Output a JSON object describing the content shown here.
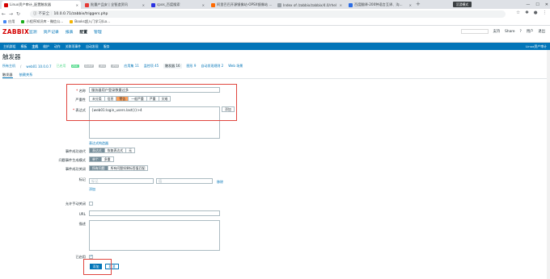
{
  "browser": {
    "tabs": [
      {
        "title": "Linux资产审计_配置触发器",
        "color": "#d40000",
        "active": true
      },
      {
        "title": "批量产品安 | 全智造资讯"
      },
      {
        "title": "cpos_百度搜索"
      },
      {
        "title": "阿里巴巴开源镜像站-OPSX镜像站 ..."
      },
      {
        "title": "Index of /zabbix/zabbix/4.0/rhel"
      },
      {
        "title": "百度翻译-200种语言互译、沟..."
      }
    ],
    "popup_tab": "沉浸模式",
    "new_tab": "+",
    "address": "10.0.0.71/zabbix/triggers.php",
    "insecure_label": "不安全",
    "bookmarks": [
      {
        "label": "应用",
        "color": "#4285f4"
      },
      {
        "label": "小程序知识库 - 微信公...",
        "color": "#1aad19"
      },
      {
        "label": "Books超入门学习(Lo...",
        "color": "#f4b400"
      }
    ]
  },
  "zabbix": {
    "logo": "ZABBIX",
    "menu": [
      "监测",
      "资产记录",
      "报表",
      "配置",
      "管理"
    ],
    "menu_selected": "配置",
    "top_right": [
      "支持",
      "Share",
      "?",
      "用户",
      "退出"
    ],
    "submenu": [
      "主机群组",
      "模板",
      "主机",
      "维护",
      "动作",
      "关联项事件",
      "自动发现",
      "服务"
    ],
    "submenu_user": "Linux资产审计",
    "page_title": "触发器",
    "breadcrumbs": [
      "所有主机",
      "/",
      "web01 10.0.0.7",
      "已启用",
      "ZBX",
      "SNMP",
      "JMX",
      "IPMI",
      "应用集 11",
      "监控项 45",
      "触发器 16",
      "图形 9",
      "自动发现规则 2",
      "Web 场景"
    ],
    "form_tabs": [
      "触发器",
      "依赖关系"
    ],
    "form": {
      "name_label": "名称",
      "name_value": "服务器用户登录数量过多",
      "severity_label": "严重性",
      "severity_options": [
        "未分类",
        "信息",
        "警告",
        "一般严重",
        "严重",
        "灾难"
      ],
      "severity_selected": "警告",
      "expression_label": "表达式",
      "expression_value": "{web01:login_users.last()}>4",
      "add_button": "添加",
      "expr_constructor": "表达式构造器",
      "event_gen_label": "事件成功迭代",
      "event_gen_options": [
        "表达式",
        "恢复表达式",
        "无"
      ],
      "problem_mode_label": "问题事件生成模式",
      "problem_mode_options": [
        "单个",
        "多重"
      ],
      "ok_close_label": "事件成功关闭",
      "ok_close_options": [
        "所有问题",
        "所有问题如果标签值匹配"
      ],
      "tags_label": "标记",
      "tag_placeholder": "标记",
      "value_placeholder": "值",
      "remove_link": "移除",
      "add_link": "添加",
      "manual_close_label": "允许手动关闭",
      "url_label": "URL",
      "desc_label": "描述",
      "enabled_label": "已启用",
      "submit_button": "添加",
      "cancel_button": "取消"
    }
  }
}
